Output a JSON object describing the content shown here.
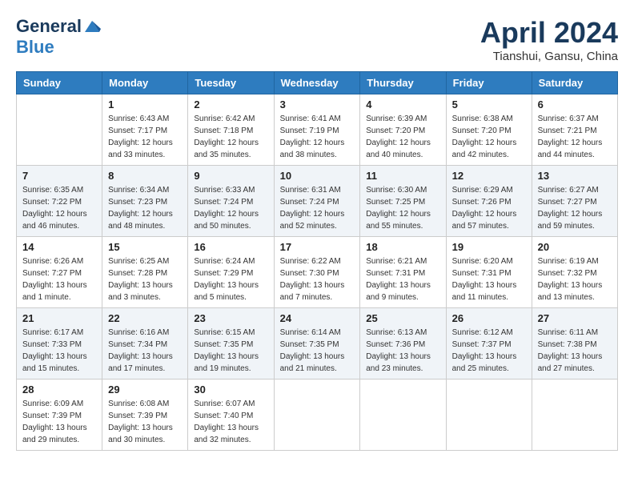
{
  "logo": {
    "general": "General",
    "blue": "Blue"
  },
  "title": "April 2024",
  "subtitle": "Tianshui, Gansu, China",
  "days_of_week": [
    "Sunday",
    "Monday",
    "Tuesday",
    "Wednesday",
    "Thursday",
    "Friday",
    "Saturday"
  ],
  "weeks": [
    [
      {
        "day": "",
        "info": ""
      },
      {
        "day": "1",
        "info": "Sunrise: 6:43 AM\nSunset: 7:17 PM\nDaylight: 12 hours\nand 33 minutes."
      },
      {
        "day": "2",
        "info": "Sunrise: 6:42 AM\nSunset: 7:18 PM\nDaylight: 12 hours\nand 35 minutes."
      },
      {
        "day": "3",
        "info": "Sunrise: 6:41 AM\nSunset: 7:19 PM\nDaylight: 12 hours\nand 38 minutes."
      },
      {
        "day": "4",
        "info": "Sunrise: 6:39 AM\nSunset: 7:20 PM\nDaylight: 12 hours\nand 40 minutes."
      },
      {
        "day": "5",
        "info": "Sunrise: 6:38 AM\nSunset: 7:20 PM\nDaylight: 12 hours\nand 42 minutes."
      },
      {
        "day": "6",
        "info": "Sunrise: 6:37 AM\nSunset: 7:21 PM\nDaylight: 12 hours\nand 44 minutes."
      }
    ],
    [
      {
        "day": "7",
        "info": "Sunrise: 6:35 AM\nSunset: 7:22 PM\nDaylight: 12 hours\nand 46 minutes."
      },
      {
        "day": "8",
        "info": "Sunrise: 6:34 AM\nSunset: 7:23 PM\nDaylight: 12 hours\nand 48 minutes."
      },
      {
        "day": "9",
        "info": "Sunrise: 6:33 AM\nSunset: 7:24 PM\nDaylight: 12 hours\nand 50 minutes."
      },
      {
        "day": "10",
        "info": "Sunrise: 6:31 AM\nSunset: 7:24 PM\nDaylight: 12 hours\nand 52 minutes."
      },
      {
        "day": "11",
        "info": "Sunrise: 6:30 AM\nSunset: 7:25 PM\nDaylight: 12 hours\nand 55 minutes."
      },
      {
        "day": "12",
        "info": "Sunrise: 6:29 AM\nSunset: 7:26 PM\nDaylight: 12 hours\nand 57 minutes."
      },
      {
        "day": "13",
        "info": "Sunrise: 6:27 AM\nSunset: 7:27 PM\nDaylight: 12 hours\nand 59 minutes."
      }
    ],
    [
      {
        "day": "14",
        "info": "Sunrise: 6:26 AM\nSunset: 7:27 PM\nDaylight: 13 hours\nand 1 minute."
      },
      {
        "day": "15",
        "info": "Sunrise: 6:25 AM\nSunset: 7:28 PM\nDaylight: 13 hours\nand 3 minutes."
      },
      {
        "day": "16",
        "info": "Sunrise: 6:24 AM\nSunset: 7:29 PM\nDaylight: 13 hours\nand 5 minutes."
      },
      {
        "day": "17",
        "info": "Sunrise: 6:22 AM\nSunset: 7:30 PM\nDaylight: 13 hours\nand 7 minutes."
      },
      {
        "day": "18",
        "info": "Sunrise: 6:21 AM\nSunset: 7:31 PM\nDaylight: 13 hours\nand 9 minutes."
      },
      {
        "day": "19",
        "info": "Sunrise: 6:20 AM\nSunset: 7:31 PM\nDaylight: 13 hours\nand 11 minutes."
      },
      {
        "day": "20",
        "info": "Sunrise: 6:19 AM\nSunset: 7:32 PM\nDaylight: 13 hours\nand 13 minutes."
      }
    ],
    [
      {
        "day": "21",
        "info": "Sunrise: 6:17 AM\nSunset: 7:33 PM\nDaylight: 13 hours\nand 15 minutes."
      },
      {
        "day": "22",
        "info": "Sunrise: 6:16 AM\nSunset: 7:34 PM\nDaylight: 13 hours\nand 17 minutes."
      },
      {
        "day": "23",
        "info": "Sunrise: 6:15 AM\nSunset: 7:35 PM\nDaylight: 13 hours\nand 19 minutes."
      },
      {
        "day": "24",
        "info": "Sunrise: 6:14 AM\nSunset: 7:35 PM\nDaylight: 13 hours\nand 21 minutes."
      },
      {
        "day": "25",
        "info": "Sunrise: 6:13 AM\nSunset: 7:36 PM\nDaylight: 13 hours\nand 23 minutes."
      },
      {
        "day": "26",
        "info": "Sunrise: 6:12 AM\nSunset: 7:37 PM\nDaylight: 13 hours\nand 25 minutes."
      },
      {
        "day": "27",
        "info": "Sunrise: 6:11 AM\nSunset: 7:38 PM\nDaylight: 13 hours\nand 27 minutes."
      }
    ],
    [
      {
        "day": "28",
        "info": "Sunrise: 6:09 AM\nSunset: 7:39 PM\nDaylight: 13 hours\nand 29 minutes."
      },
      {
        "day": "29",
        "info": "Sunrise: 6:08 AM\nSunset: 7:39 PM\nDaylight: 13 hours\nand 30 minutes."
      },
      {
        "day": "30",
        "info": "Sunrise: 6:07 AM\nSunset: 7:40 PM\nDaylight: 13 hours\nand 32 minutes."
      },
      {
        "day": "",
        "info": ""
      },
      {
        "day": "",
        "info": ""
      },
      {
        "day": "",
        "info": ""
      },
      {
        "day": "",
        "info": ""
      }
    ]
  ]
}
